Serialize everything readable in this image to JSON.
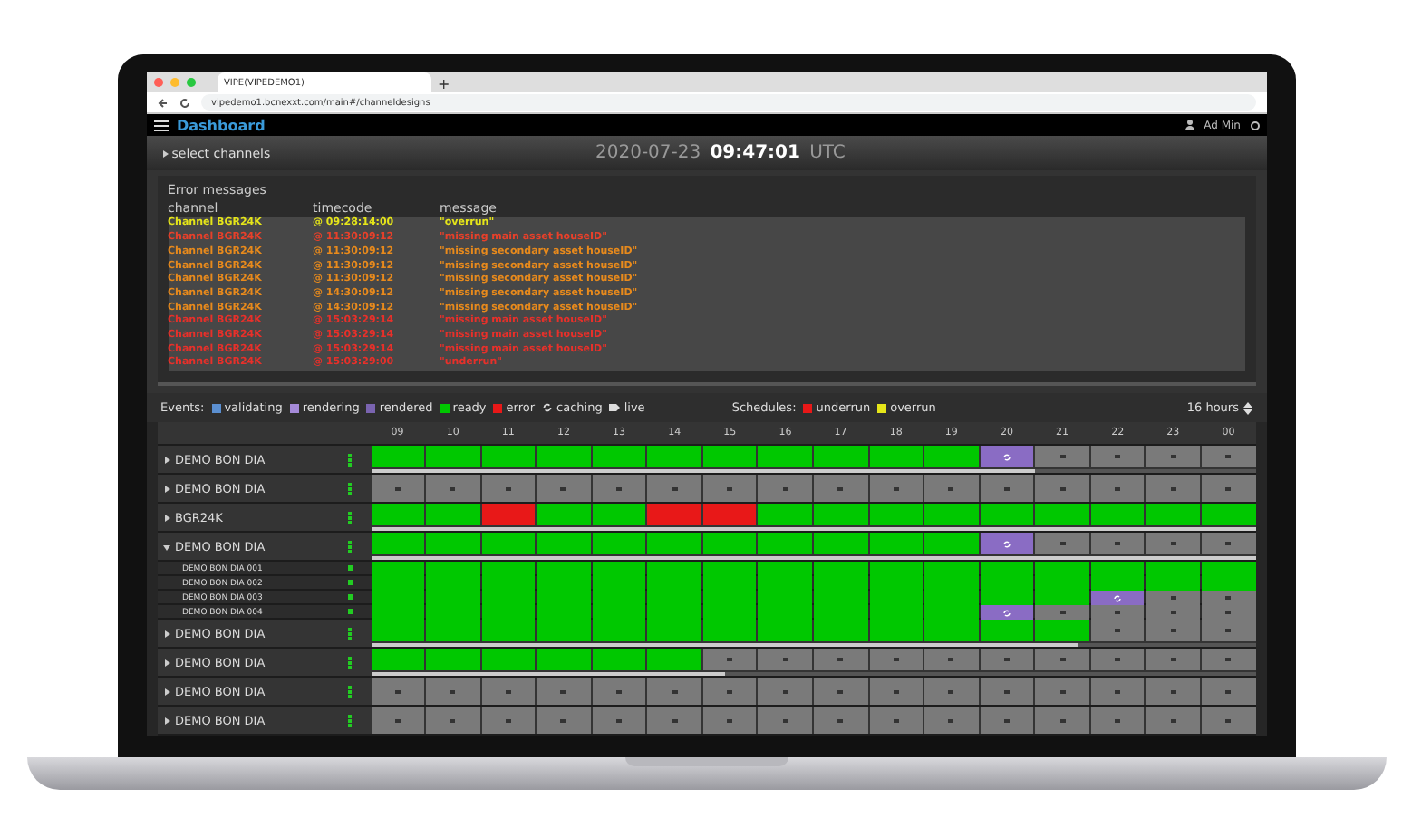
{
  "browser": {
    "tab_title": "VIPE(VIPEDEMO1)",
    "new_tab": "+",
    "url": "vipedemo1.bcnexxt.com/main#/channeldesigns"
  },
  "header": {
    "title": "Dashboard",
    "user": "Ad Min"
  },
  "date_bar": {
    "toggle": "select channels",
    "date": "2020-07-23",
    "time": "09:47:01",
    "zone": "UTC"
  },
  "errors": {
    "title": "Error messages",
    "columns": [
      "channel",
      "timecode",
      "message"
    ],
    "rows": [
      {
        "channel": "Channel BGR24K",
        "timecode": "@ 09:28:14:00",
        "message": "\"overrun\"",
        "color": "#e6e619"
      },
      {
        "channel": "Channel BGR24K",
        "timecode": "@ 11:30:09:12",
        "message": "\"missing main asset houseID\"",
        "color": "#e8402a"
      },
      {
        "channel": "Channel BGR24K",
        "timecode": "@ 11:30:09:12",
        "message": "\"missing secondary asset houseID\"",
        "color": "#e88a1c"
      },
      {
        "channel": "Channel BGR24K",
        "timecode": "@ 11:30:09:12",
        "message": "\"missing secondary asset houseID\"",
        "color": "#e88a1c"
      },
      {
        "channel": "Channel BGR24K",
        "timecode": "@ 11:30:09:12",
        "message": "\"missing secondary asset houseID\"",
        "color": "#e88a1c"
      },
      {
        "channel": "Channel BGR24K",
        "timecode": "@ 14:30:09:12",
        "message": "\"missing secondary asset houseID\"",
        "color": "#e88a1c"
      },
      {
        "channel": "Channel BGR24K",
        "timecode": "@ 14:30:09:12",
        "message": "\"missing secondary asset houseID\"",
        "color": "#e88a1c"
      },
      {
        "channel": "Channel BGR24K",
        "timecode": "@ 15:03:29:14",
        "message": "\"missing main asset houseID\"",
        "color": "#e8302a"
      },
      {
        "channel": "Channel BGR24K",
        "timecode": "@ 15:03:29:14",
        "message": "\"missing main asset houseID\"",
        "color": "#e8302a"
      },
      {
        "channel": "Channel BGR24K",
        "timecode": "@ 15:03:29:14",
        "message": "\"missing main asset houseID\"",
        "color": "#e8302a"
      },
      {
        "channel": "Channel BGR24K",
        "timecode": "@ 15:03:29:00",
        "message": "\"underrun\"",
        "color": "#e8302a"
      }
    ]
  },
  "legend": {
    "events_label": "Events:",
    "events": [
      {
        "label": "validating",
        "kind": "swatch",
        "color": "#5b8fd0"
      },
      {
        "label": "rendering",
        "kind": "swatch",
        "color": "#a58ad8"
      },
      {
        "label": "rendered",
        "kind": "swatch",
        "color": "#7a64b0"
      },
      {
        "label": "ready",
        "kind": "swatch",
        "color": "#00c800"
      },
      {
        "label": "error",
        "kind": "swatch",
        "color": "#e81818"
      },
      {
        "label": "caching",
        "kind": "sync"
      },
      {
        "label": "live",
        "kind": "live"
      }
    ],
    "schedules_label": "Schedules:",
    "schedules": [
      {
        "label": "underrun",
        "color": "#e81818"
      },
      {
        "label": "overrun",
        "color": "#e6e619"
      }
    ],
    "range": "16 hours"
  },
  "timeline": {
    "hours": [
      "09",
      "10",
      "11",
      "12",
      "13",
      "14",
      "15",
      "16",
      "17",
      "18",
      "19",
      "20",
      "21",
      "22",
      "23",
      "00"
    ],
    "rows": [
      {
        "name": "DEMO BON DIA",
        "expanded": false,
        "level": 0.75,
        "cells": [
          {
            "kind": "ready"
          },
          {
            "kind": "ready"
          },
          {
            "kind": "ready"
          },
          {
            "kind": "ready"
          },
          {
            "kind": "ready"
          },
          {
            "kind": "ready"
          },
          {
            "kind": "ready"
          },
          {
            "kind": "ready"
          },
          {
            "kind": "ready"
          },
          {
            "kind": "ready"
          },
          {
            "kind": "ready"
          },
          {
            "kind": "rendering"
          },
          {
            "kind": "empty"
          },
          {
            "kind": "empty"
          },
          {
            "kind": "empty"
          },
          {
            "kind": "empty"
          }
        ],
        "children": []
      },
      {
        "name": "DEMO BON DIA",
        "expanded": false,
        "cells": [
          {
            "kind": "empty"
          },
          {
            "kind": "empty"
          },
          {
            "kind": "empty"
          },
          {
            "kind": "empty"
          },
          {
            "kind": "empty"
          },
          {
            "kind": "empty"
          },
          {
            "kind": "empty"
          },
          {
            "kind": "empty"
          },
          {
            "kind": "empty"
          },
          {
            "kind": "empty"
          },
          {
            "kind": "empty"
          },
          {
            "kind": "empty"
          },
          {
            "kind": "empty"
          },
          {
            "kind": "empty"
          },
          {
            "kind": "empty"
          },
          {
            "kind": "empty"
          }
        ],
        "children": []
      },
      {
        "name": "BGR24K",
        "expanded": false,
        "level": 1,
        "cells": [
          {
            "kind": "ready"
          },
          {
            "kind": "ready"
          },
          {
            "kind": "error"
          },
          {
            "kind": "ready"
          },
          {
            "kind": "ready"
          },
          {
            "kind": "error"
          },
          {
            "kind": "error"
          },
          {
            "kind": "ready"
          },
          {
            "kind": "ready"
          },
          {
            "kind": "ready"
          },
          {
            "kind": "ready"
          },
          {
            "kind": "ready"
          },
          {
            "kind": "ready"
          },
          {
            "kind": "ready"
          },
          {
            "kind": "ready"
          },
          {
            "kind": "ready"
          }
        ],
        "children": []
      },
      {
        "name": "DEMO BON DIA",
        "expanded": true,
        "level": 1,
        "cells": [
          {
            "kind": "ready"
          },
          {
            "kind": "ready"
          },
          {
            "kind": "ready"
          },
          {
            "kind": "ready"
          },
          {
            "kind": "ready"
          },
          {
            "kind": "ready"
          },
          {
            "kind": "ready"
          },
          {
            "kind": "ready"
          },
          {
            "kind": "ready"
          },
          {
            "kind": "ready"
          },
          {
            "kind": "ready"
          },
          {
            "kind": "rendering"
          },
          {
            "kind": "empty"
          },
          {
            "kind": "empty"
          },
          {
            "kind": "empty"
          },
          {
            "kind": "empty"
          }
        ],
        "children": [
          {
            "name": "DEMO BON DIA 001",
            "cells": [
              {
                "kind": "ready"
              },
              {
                "kind": "ready"
              },
              {
                "kind": "ready"
              },
              {
                "kind": "ready"
              },
              {
                "kind": "ready"
              },
              {
                "kind": "ready"
              },
              {
                "kind": "ready"
              },
              {
                "kind": "ready"
              },
              {
                "kind": "ready"
              },
              {
                "kind": "ready"
              },
              {
                "kind": "ready"
              },
              {
                "kind": "ready"
              },
              {
                "kind": "ready"
              },
              {
                "kind": "ready"
              },
              {
                "kind": "ready"
              },
              {
                "kind": "ready"
              }
            ]
          },
          {
            "name": "DEMO BON DIA 002",
            "cells": [
              {
                "kind": "ready"
              },
              {
                "kind": "ready"
              },
              {
                "kind": "ready"
              },
              {
                "kind": "ready"
              },
              {
                "kind": "ready"
              },
              {
                "kind": "ready"
              },
              {
                "kind": "ready"
              },
              {
                "kind": "ready"
              },
              {
                "kind": "ready"
              },
              {
                "kind": "ready"
              },
              {
                "kind": "ready"
              },
              {
                "kind": "ready"
              },
              {
                "kind": "ready"
              },
              {
                "kind": "ready"
              },
              {
                "kind": "ready"
              },
              {
                "kind": "ready"
              }
            ]
          },
          {
            "name": "DEMO BON DIA 003",
            "cells": [
              {
                "kind": "ready"
              },
              {
                "kind": "ready"
              },
              {
                "kind": "ready"
              },
              {
                "kind": "ready"
              },
              {
                "kind": "ready"
              },
              {
                "kind": "ready"
              },
              {
                "kind": "ready"
              },
              {
                "kind": "ready"
              },
              {
                "kind": "ready"
              },
              {
                "kind": "ready"
              },
              {
                "kind": "ready"
              },
              {
                "kind": "ready"
              },
              {
                "kind": "ready"
              },
              {
                "kind": "rendering"
              },
              {
                "kind": "empty"
              },
              {
                "kind": "empty"
              }
            ]
          },
          {
            "name": "DEMO BON DIA 004",
            "cells": [
              {
                "kind": "ready"
              },
              {
                "kind": "ready"
              },
              {
                "kind": "ready"
              },
              {
                "kind": "ready"
              },
              {
                "kind": "ready"
              },
              {
                "kind": "ready"
              },
              {
                "kind": "ready"
              },
              {
                "kind": "ready"
              },
              {
                "kind": "ready"
              },
              {
                "kind": "ready"
              },
              {
                "kind": "ready"
              },
              {
                "kind": "rendering"
              },
              {
                "kind": "empty"
              },
              {
                "kind": "empty"
              },
              {
                "kind": "empty"
              },
              {
                "kind": "empty"
              }
            ]
          }
        ]
      },
      {
        "name": "DEMO BON DIA",
        "expanded": false,
        "level": 0.8,
        "cells": [
          {
            "kind": "ready"
          },
          {
            "kind": "ready"
          },
          {
            "kind": "ready"
          },
          {
            "kind": "ready"
          },
          {
            "kind": "ready"
          },
          {
            "kind": "ready"
          },
          {
            "kind": "ready"
          },
          {
            "kind": "ready"
          },
          {
            "kind": "ready"
          },
          {
            "kind": "ready"
          },
          {
            "kind": "ready"
          },
          {
            "kind": "ready"
          },
          {
            "kind": "ready"
          },
          {
            "kind": "empty"
          },
          {
            "kind": "empty"
          },
          {
            "kind": "empty"
          }
        ],
        "children": []
      },
      {
        "name": "DEMO BON DIA",
        "expanded": false,
        "level": 0.4,
        "cells": [
          {
            "kind": "ready"
          },
          {
            "kind": "ready"
          },
          {
            "kind": "ready"
          },
          {
            "kind": "ready"
          },
          {
            "kind": "ready"
          },
          {
            "kind": "ready"
          },
          {
            "kind": "empty"
          },
          {
            "kind": "empty"
          },
          {
            "kind": "empty"
          },
          {
            "kind": "empty"
          },
          {
            "kind": "empty"
          },
          {
            "kind": "empty"
          },
          {
            "kind": "empty"
          },
          {
            "kind": "empty"
          },
          {
            "kind": "empty"
          },
          {
            "kind": "empty"
          }
        ],
        "children": []
      },
      {
        "name": "DEMO BON DIA",
        "expanded": false,
        "cells": [
          {
            "kind": "empty"
          },
          {
            "kind": "empty"
          },
          {
            "kind": "empty"
          },
          {
            "kind": "empty"
          },
          {
            "kind": "empty"
          },
          {
            "kind": "empty"
          },
          {
            "kind": "empty"
          },
          {
            "kind": "empty"
          },
          {
            "kind": "empty"
          },
          {
            "kind": "empty"
          },
          {
            "kind": "empty"
          },
          {
            "kind": "empty"
          },
          {
            "kind": "empty"
          },
          {
            "kind": "empty"
          },
          {
            "kind": "empty"
          },
          {
            "kind": "empty"
          }
        ],
        "children": []
      },
      {
        "name": "DEMO BON DIA",
        "expanded": false,
        "cells": [
          {
            "kind": "empty"
          },
          {
            "kind": "empty"
          },
          {
            "kind": "empty"
          },
          {
            "kind": "empty"
          },
          {
            "kind": "empty"
          },
          {
            "kind": "empty"
          },
          {
            "kind": "empty"
          },
          {
            "kind": "empty"
          },
          {
            "kind": "empty"
          },
          {
            "kind": "empty"
          },
          {
            "kind": "empty"
          },
          {
            "kind": "empty"
          },
          {
            "kind": "empty"
          },
          {
            "kind": "empty"
          },
          {
            "kind": "empty"
          },
          {
            "kind": "empty"
          }
        ],
        "children": []
      }
    ]
  }
}
